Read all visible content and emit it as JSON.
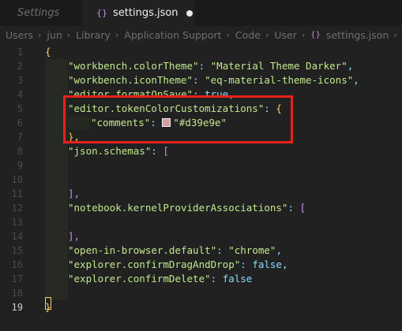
{
  "tabs": {
    "inactive_label": "Settings",
    "active_label": "settings.json",
    "file_icon": "braces-icon",
    "unsaved_indicator": "dirty-dot"
  },
  "breadcrumb": [
    "Users",
    "jun",
    "Library",
    "Application Support",
    "Code",
    "User",
    "settings.json",
    "..."
  ],
  "editor": {
    "current_line": 19,
    "line_numbers": [
      "1",
      "2",
      "3",
      "4",
      "5",
      "6",
      "7",
      "8",
      "9",
      "10",
      "11",
      "12",
      "13",
      "14",
      "15",
      "16",
      "17",
      "18",
      "19"
    ],
    "lines": {
      "l1": "{",
      "l2": {
        "key": "\"workbench.colorTheme\"",
        "sep": ": ",
        "value": "\"Material Theme Darker\"",
        "tail": ","
      },
      "l3": {
        "key": "\"workbench.iconTheme\"",
        "sep": ": ",
        "value": "\"eq-material-theme-icons\"",
        "tail": ","
      },
      "l4": {
        "key": "\"editor.formatOnSave\"",
        "sep": ": ",
        "value": "true",
        "tail": ","
      },
      "l5": {
        "key": "\"editor.tokenColorCustomizations\"",
        "sep": ": ",
        "value": "{"
      },
      "l6": {
        "key": "\"comments\"",
        "sep": ": ",
        "value": "\"#d39e9e\""
      },
      "l7": "},",
      "l8": {
        "key": "\"json.schemas\"",
        "sep": ": ",
        "value": "["
      },
      "l11": "],",
      "l12": {
        "key": "\"notebook.kernelProviderAssociations\"",
        "sep": ": ",
        "value": "["
      },
      "l14": "],",
      "l15": {
        "key": "\"open-in-browser.default\"",
        "sep": ": ",
        "value": "\"chrome\"",
        "tail": ","
      },
      "l16": {
        "key": "\"explorer.confirmDragAndDrop\"",
        "sep": ": ",
        "value": "false",
        "tail": ","
      },
      "l17": {
        "key": "\"explorer.confirmDelete\"",
        "sep": ": ",
        "value": "false"
      },
      "l19": "}"
    }
  },
  "colors": {
    "background": "#212121",
    "string": "#c3e88d",
    "punctuation": "#89ddff",
    "brace": "#ffcb6b",
    "highlight_box": "#e8201c",
    "swatch": "#d39e9e"
  }
}
